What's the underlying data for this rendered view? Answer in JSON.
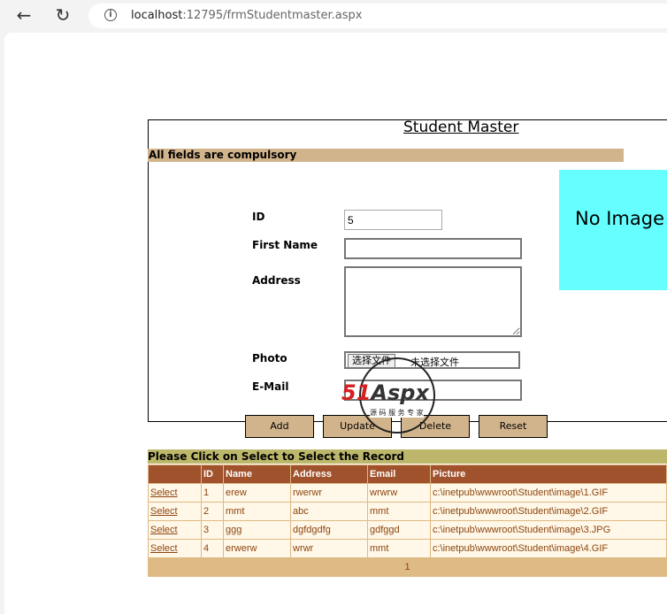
{
  "browser": {
    "url_host": "localhost",
    "url_rest": ":12795/frmStudentmaster.aspx"
  },
  "form": {
    "title": "Student Master",
    "notice": "All fields are compulsory",
    "labels": {
      "id": "ID",
      "first_name": "First Name",
      "address": "Address",
      "photo": "Photo",
      "email": "E-Mail"
    },
    "values": {
      "id": "5",
      "first_name": "",
      "address": "",
      "email": ""
    },
    "file_choose_label": "选择文件",
    "file_none_label": "未选择文件",
    "no_image": "No Image",
    "buttons": {
      "add": "Add",
      "update": "Update",
      "delete": "Delete",
      "reset": "Reset"
    }
  },
  "grid": {
    "hint": "Please Click on Select to Select the Record",
    "columns": [
      "",
      "ID",
      "Name",
      "Address",
      "Email",
      "Picture"
    ],
    "rows": [
      {
        "select": "Select",
        "id": "1",
        "name": "erew",
        "address": "rwerwr",
        "email": "wrwrw",
        "picture": "c:\\inetpub\\wwwroot\\Student\\image\\1.GIF"
      },
      {
        "select": "Select",
        "id": "2",
        "name": "mmt",
        "address": "abc",
        "email": "mmt",
        "picture": "c:\\inetpub\\wwwroot\\Student\\image\\2.GIF"
      },
      {
        "select": "Select",
        "id": "3",
        "name": "ggg",
        "address": "dgfdgdfg",
        "email": "gdfggd",
        "picture": "c:\\inetpub\\wwwroot\\Student\\image\\3.JPG"
      },
      {
        "select": "Select",
        "id": "4",
        "name": "erwerw",
        "address": "wrwr",
        "email": "mmt",
        "picture": "c:\\inetpub\\wwwroot\\Student\\image\\4.GIF"
      }
    ],
    "pager": "1"
  },
  "watermark": {
    "brand_red": "51",
    "brand_dark": "Aspx",
    "tagline": "源 码 服 务 专 家"
  },
  "colors": {
    "notice_bg": "#d2b48c",
    "hint_bg": "#bdb76b",
    "header_bg": "#a0522d",
    "no_image_bg": "#66ffff"
  }
}
